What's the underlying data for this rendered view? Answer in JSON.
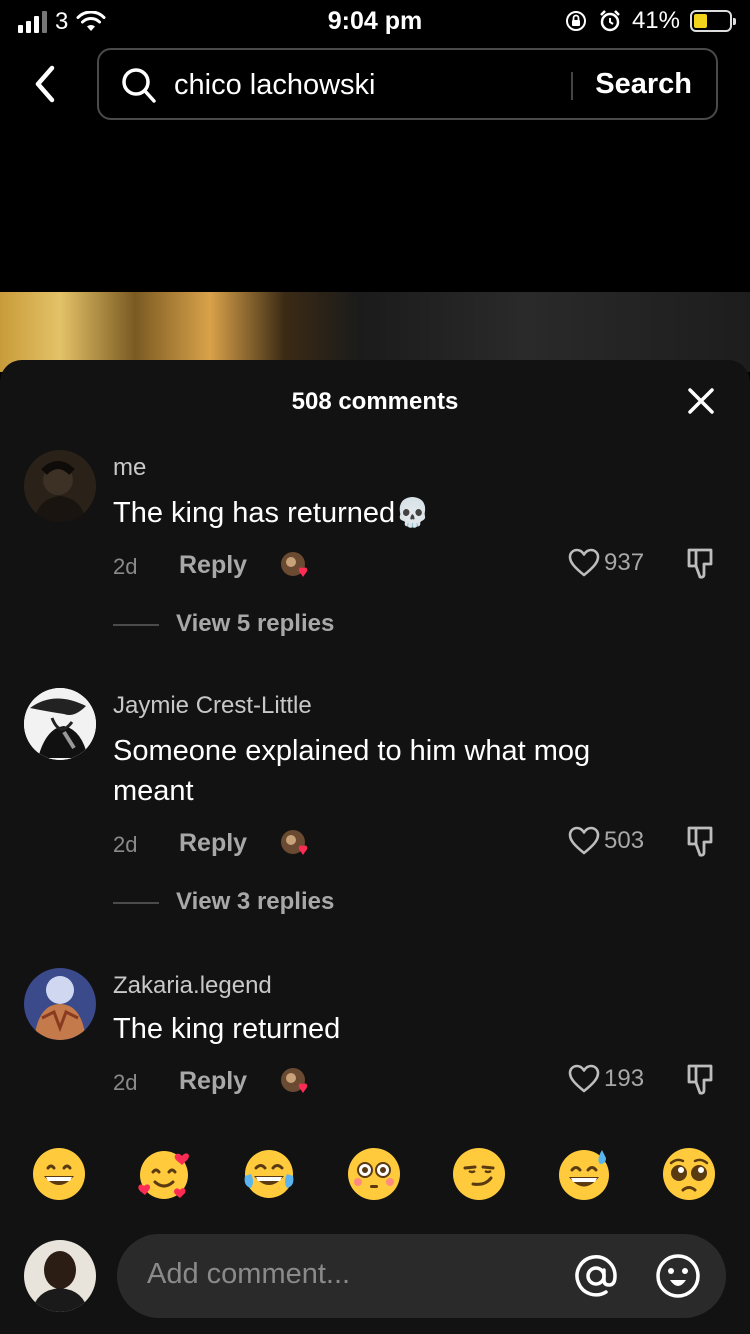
{
  "status_bar": {
    "carrier": "3",
    "time": "9:04 pm",
    "battery": "41%",
    "battery_level": 0.41
  },
  "search": {
    "query": "chico lachowski",
    "button_label": "Search"
  },
  "comments_panel": {
    "title": "508 comments",
    "comments": [
      {
        "user": "me",
        "text": "The king has returned",
        "emoji": "💀",
        "time": "2d",
        "reply_label": "Reply",
        "likes": "937",
        "view_replies": "View 5 replies"
      },
      {
        "user": "Jaymie Crest-Little",
        "text": "Someone explained to him what mog meant",
        "time": "2d",
        "reply_label": "Reply",
        "likes": "503",
        "view_replies": "View 3 replies"
      },
      {
        "user": "Zakaria.legend",
        "text": "The king returned",
        "time": "2d",
        "reply_label": "Reply",
        "likes": "193"
      }
    ]
  },
  "emoji_bar": [
    "grinning-face",
    "smiling-face-with-hearts",
    "face-with-tears-of-joy",
    "flushed-face",
    "smirking-face",
    "grinning-face-with-sweat",
    "pleading-face"
  ],
  "input": {
    "placeholder": "Add comment..."
  },
  "colors": {
    "sheet_bg": "#121212",
    "heart_red": "#fe2c55",
    "emoji_yellow": "#ffcb3d"
  }
}
